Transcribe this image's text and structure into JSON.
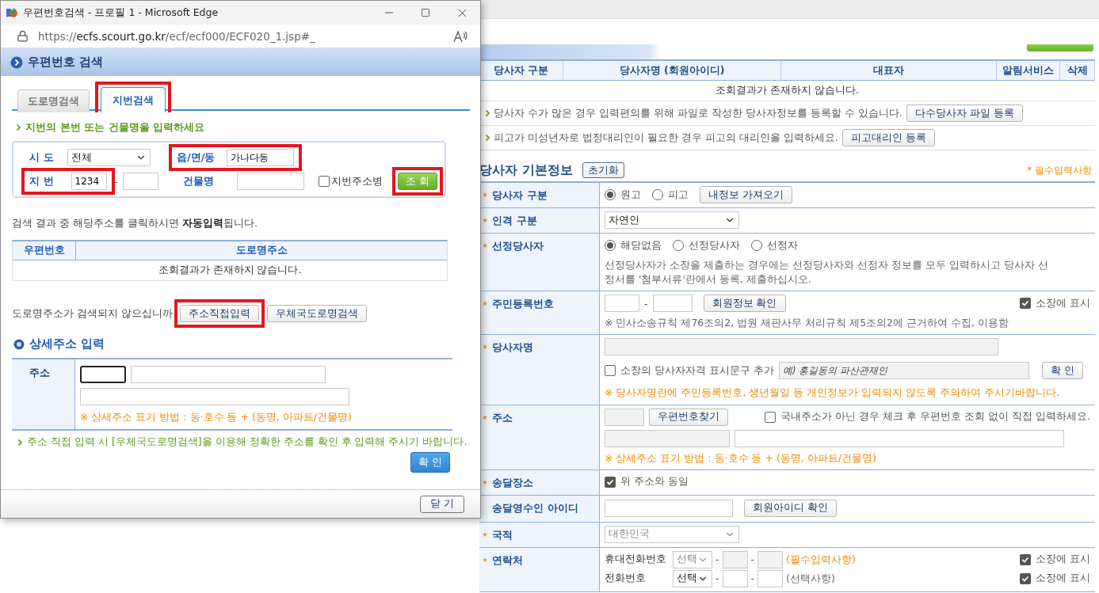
{
  "popup": {
    "title": "우편번호검색 - 프로필 1 - Microsoft Edge",
    "url": {
      "scheme": "https://",
      "host": "ecfs.scourt.go.kr",
      "path": "/ecf/ecf000/ECF020_1.jsp#_"
    },
    "heading": "우편번호 검색",
    "tabs": [
      {
        "label": "도로명검색",
        "selected": false,
        "highlighted": false
      },
      {
        "label": "지번검색",
        "selected": true,
        "highlighted": true
      }
    ],
    "instruction": "지번의 본번 또는 건물명을 입력하세요",
    "search_form": {
      "sido": {
        "label": "시 도",
        "value": "전체"
      },
      "eup": {
        "label": "읍/면/동",
        "value": "가나다동",
        "highlighted": true
      },
      "jibun": {
        "label": "지 번",
        "main": "1234",
        "separator": "-",
        "highlighted": true
      },
      "building": {
        "label": "건물명"
      },
      "merge": {
        "label": "지번주소병",
        "checked": false
      },
      "search_button": {
        "label": "조 회",
        "highlighted": true
      }
    },
    "result_hint": "검색 결과 중 해당주소를 클릭하시면 **자동입력**됩니다.",
    "results_table": {
      "columns": [
        "우편번호",
        "도로명주소"
      ],
      "empty": "조회결과가 존재하지 않습니다."
    },
    "not_found": {
      "text": "도로명주소가 검색되지 않으십니까",
      "buttons": [
        {
          "label": "주소직접입력",
          "highlighted": true
        },
        {
          "label": "우체국도로명검색",
          "highlighted": false
        }
      ]
    },
    "detail": {
      "heading": "상세주소 입력",
      "label": "주소",
      "note": "※ 상세주소 표기 방법 : 동·호수 등 + (동명, 아파트/건물명)"
    },
    "notice": "주소 직접 입력 시 [우체국도로명검색]을 이용해 정확한 주소를 확인 후 입력해 주시기 바랍니다.",
    "confirm_button": "확 인",
    "close_button": "닫 기"
  },
  "page": {
    "party_table": {
      "columns": [
        "당사자 구분",
        "당사자명 (회원아이디)",
        "대표자",
        "알림서비스",
        "삭제"
      ],
      "empty": "조회결과가 존재하지 않습니다."
    },
    "tips": [
      {
        "text": "당사자 수가 많은 경우 입력편의를 위해 파일로 작성한 당사자정보를 등록할 수 있습니다.",
        "button": "다수당사자 파일 등록"
      },
      {
        "text": "피고가 미성년자로 법정대리인이 필요한 경우 피고의 대리인을 입력하세요.",
        "button": "피고대리인 등록"
      }
    ],
    "section": {
      "title": "당사자 기본정보",
      "reset_button": "초기화",
      "required_note": "* 필수입력사항"
    },
    "rows": [
      {
        "kind": "radio",
        "label": "당사자 구분",
        "required": true,
        "options": [
          {
            "label": "원고",
            "selected": true
          },
          {
            "label": "피고",
            "selected": false
          }
        ],
        "button": "내정보 가져오기"
      },
      {
        "kind": "select",
        "label": "인격 구분",
        "required": true,
        "value": "자연인",
        "disabled": false
      },
      {
        "kind": "radio",
        "label": "선정당사자",
        "required": true,
        "options": [
          {
            "label": "해당없음",
            "selected": true
          },
          {
            "label": "선정당사자",
            "selected": false
          },
          {
            "label": "선정자",
            "selected": false
          }
        ],
        "note": "선정당사자가 소장을 제출하는 경우에는 선정당사자와 선정자 정보를 모두 입력하시고 당사자 선정서를 '첨부서류'란에서 등록, 제출하십시오."
      },
      {
        "kind": "rrn",
        "label": "주민등록번호",
        "required": true,
        "separator": "-",
        "button": "회원정보 확인",
        "show": {
          "label": "소장에 표시",
          "checked": true
        },
        "note": "※ 민사소송규칙 제76조의2, 법원 재판사무 처리규칙 제5조의2에 근거하여 수집, 이용함"
      },
      {
        "kind": "name",
        "label": "당사자명",
        "required": true,
        "qualifier": {
          "label": "소장의 당사자자격 표시문구 추가",
          "checked": false,
          "placeholder": "예) 홍길동의 파산관재인"
        },
        "button": "확 인",
        "warning": "※ 당사자명란에 주민등록번호, 생년월일 등 개인정보가 입력되지 않도록 주의하여 주시기바랍니다."
      },
      {
        "kind": "address",
        "label": "주소",
        "required": true,
        "button": "우편번호찾기",
        "foreign": {
          "label": "국내주소가 아닌 경우 체크 후 우편번호 조회 없이 직접 입력하세요.",
          "checked": false
        },
        "note": "※ 상세주소 표기 방법 : 동·호수 등 + (동명, 아파트/건물명)"
      },
      {
        "kind": "checkbox",
        "label": "송달장소",
        "required": true,
        "option": {
          "label": "위 주소와 동일",
          "checked": true
        }
      },
      {
        "kind": "id",
        "label": "송달영수인 아이디",
        "required": false,
        "button": "회원아이디 확인"
      },
      {
        "kind": "select",
        "label": "국적",
        "required": true,
        "value": "대한민국",
        "disabled": true
      },
      {
        "kind": "contact",
        "label": "연락처",
        "required": true,
        "phones": [
          {
            "label": "휴대전화번호",
            "select": "선택",
            "disabled": true,
            "separators": [
              "-",
              "-"
            ],
            "note": "(필수입력사항)",
            "note_required": true,
            "show": {
              "label": "소장에 표시",
              "checked": true
            }
          },
          {
            "label": "전화번호",
            "select": "선택",
            "disabled": false,
            "separators": [
              "-",
              "-"
            ],
            "note": "(선택사항)",
            "note_required": false,
            "show": {
              "label": "소장에 표시",
              "checked": true
            }
          }
        ]
      }
    ]
  }
}
